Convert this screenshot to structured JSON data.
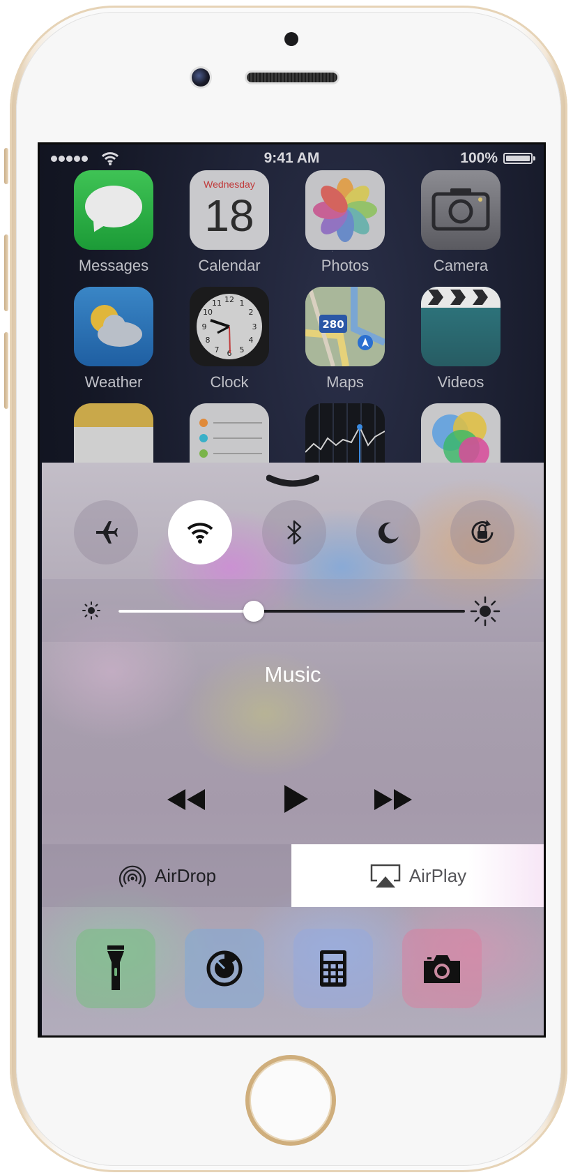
{
  "status_bar": {
    "time": "9:41 AM",
    "battery": "100%",
    "signal_icon": "signal-dots-icon",
    "wifi_icon": "wifi-icon",
    "battery_icon": "battery-icon"
  },
  "home_screen": {
    "apps": [
      {
        "label": "Messages",
        "icon": "messages-icon"
      },
      {
        "label": "Calendar",
        "icon": "calendar-icon",
        "day": "Wednesday",
        "date": "18"
      },
      {
        "label": "Photos",
        "icon": "photos-icon"
      },
      {
        "label": "Camera",
        "icon": "camera-icon"
      },
      {
        "label": "Weather",
        "icon": "weather-icon"
      },
      {
        "label": "Clock",
        "icon": "clock-icon"
      },
      {
        "label": "Maps",
        "icon": "maps-icon",
        "shield": "280"
      },
      {
        "label": "Videos",
        "icon": "videos-icon"
      },
      {
        "label": "",
        "icon": "notes-icon"
      },
      {
        "label": "",
        "icon": "reminders-icon"
      },
      {
        "label": "",
        "icon": "stocks-icon"
      },
      {
        "label": "",
        "icon": "game-center-icon"
      }
    ]
  },
  "control_center": {
    "toggles": [
      {
        "name": "airplane-mode",
        "icon": "airplane-icon",
        "on": false
      },
      {
        "name": "wifi",
        "icon": "wifi-icon",
        "on": true
      },
      {
        "name": "bluetooth",
        "icon": "bluetooth-icon",
        "on": false
      },
      {
        "name": "do-not-disturb",
        "icon": "moon-icon",
        "on": false
      },
      {
        "name": "rotation-lock",
        "icon": "rotation-lock-icon",
        "on": false
      }
    ],
    "brightness": 0.39,
    "music": {
      "title": "Music"
    },
    "airdrop_label": "AirDrop",
    "airplay_label": "AirPlay",
    "shortcuts": [
      {
        "name": "flashlight",
        "icon": "flashlight-icon"
      },
      {
        "name": "timer",
        "icon": "timer-icon"
      },
      {
        "name": "calculator",
        "icon": "calculator-icon"
      },
      {
        "name": "camera",
        "icon": "camera-icon"
      }
    ],
    "colors": {
      "toggle_on": "#ffffff",
      "airplay_active": "#ffffff"
    }
  }
}
